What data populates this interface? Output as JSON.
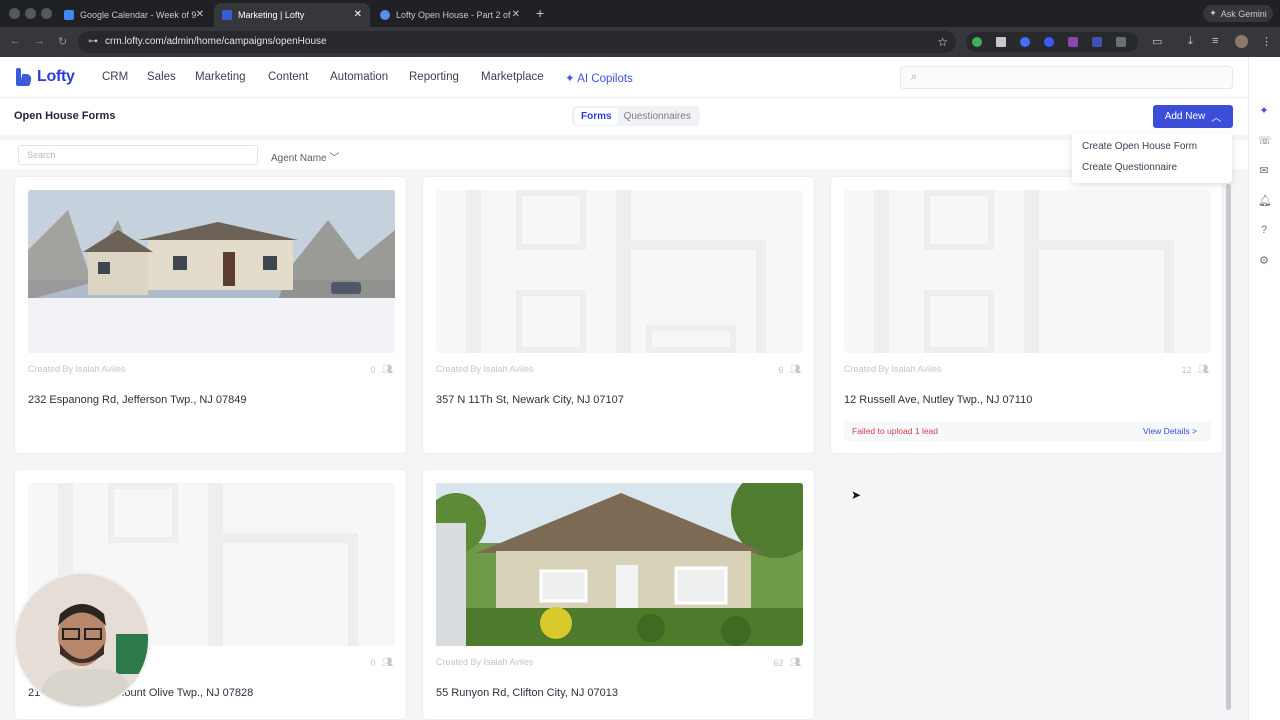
{
  "browser": {
    "tabs": [
      {
        "title": "Google Calendar - Week of 9",
        "favicon_color": "#4285f4"
      },
      {
        "title": "Marketing | Lofty",
        "favicon_color": "#3b5bdb"
      },
      {
        "title": "Lofty Open House - Part 2 of",
        "favicon_color": "#5a8dee"
      }
    ],
    "ask_gemini": "Ask Gemini",
    "url": "crm.lofty.com/admin/home/campaigns/openHouse"
  },
  "app": {
    "logo_text": "Lofty",
    "nav": [
      "CRM",
      "Sales",
      "Marketing",
      "Content",
      "Automation",
      "Reporting",
      "Marketplace"
    ],
    "ai_copilots": "AI Copilots"
  },
  "page": {
    "title": "Open House Forms",
    "segments": [
      "Forms",
      "Questionnaires"
    ],
    "add_new": "Add New",
    "dropdown": [
      "Create Open House Form",
      "Create Questionnaire"
    ],
    "search_placeholder": "Search",
    "agent_filter": "Agent Name"
  },
  "cards": [
    {
      "created_by": "Created By Isaiah Aviles",
      "count": "0",
      "address": "232 Espanong Rd, Jefferson Twp., NJ 07849",
      "image": "photo-snow-house"
    },
    {
      "created_by": "Created By Isaiah Aviles",
      "count": "6",
      "address": "357 N 11Th St, Newark City, NJ 07107",
      "image": "placeholder"
    },
    {
      "created_by": "Created By Isaiah Aviles",
      "count": "12",
      "address": "12 Russell Ave, Nutley Twp., NJ 07110",
      "image": "placeholder",
      "error": "Failed to upload 1 lead",
      "details": "View Details >"
    },
    {
      "created_by": "",
      "count": "0",
      "address": "21",
      "address_tail": "Mount Olive Twp., NJ 07828",
      "image": "placeholder"
    },
    {
      "created_by": "Created By Isaiah Aviles",
      "count": "62",
      "address": "55 Runyon Rd, Clifton City, NJ 07013",
      "image": "photo-summer-house"
    }
  ],
  "colors": {
    "accent": "#3c4ed8",
    "error": "#d3414f"
  }
}
